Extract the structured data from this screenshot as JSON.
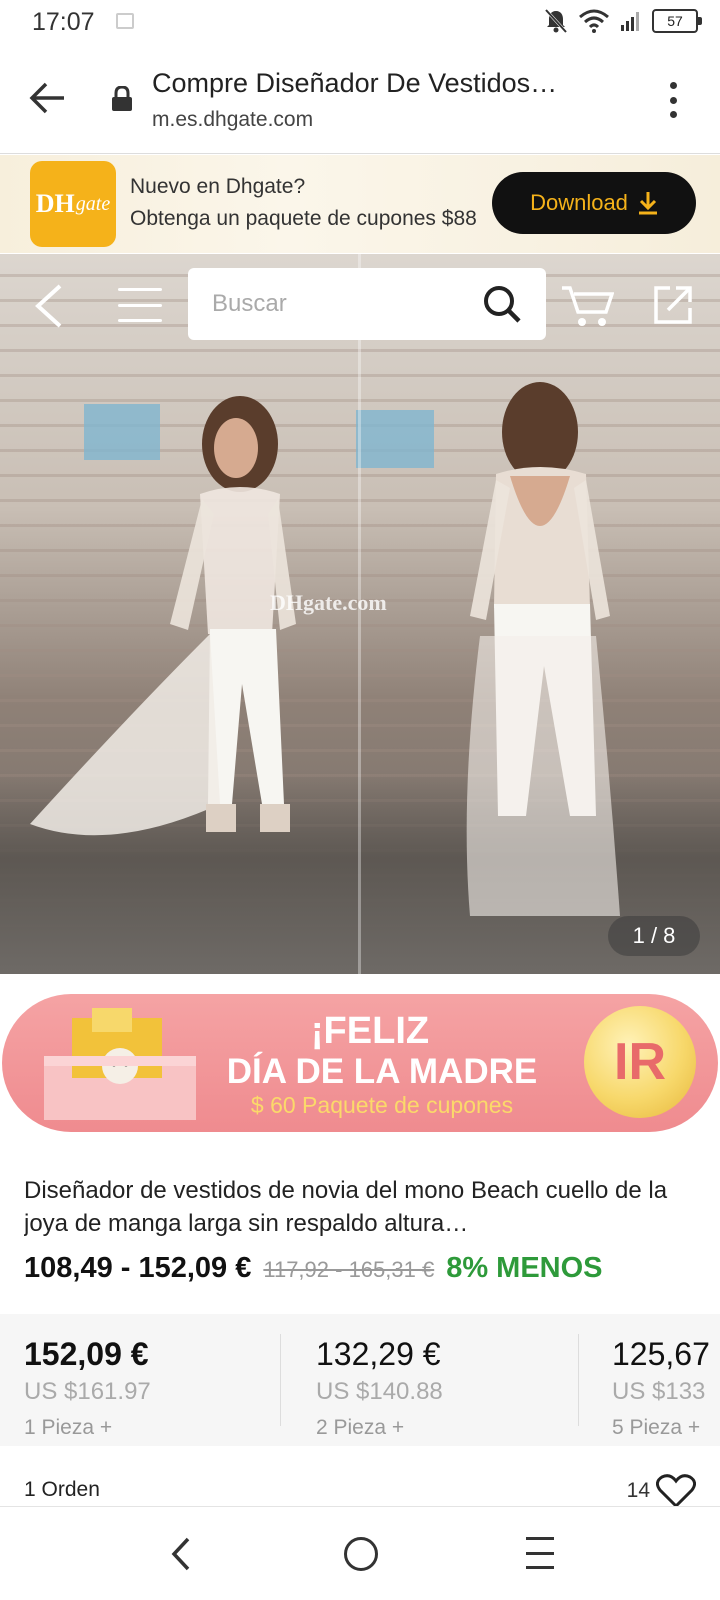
{
  "status_bar": {
    "time": "17:07",
    "battery": "57",
    "icons": [
      "image-icon",
      "mute-icon",
      "wifi-icon",
      "signal-icon",
      "battery-icon"
    ]
  },
  "browser": {
    "title": "Compre Diseñador De Vestidos…",
    "url": "m.es.dhgate.com"
  },
  "app_banner": {
    "logo_main": "DH",
    "logo_sub": "gate",
    "line1": "Nuevo en Dhgate?",
    "line2": "Obtenga un paquete de cupones $88",
    "download_label": "Download"
  },
  "hero": {
    "search_placeholder": "Buscar",
    "counter": "1 / 8",
    "watermark": "DHgate.com"
  },
  "promo": {
    "line1": "¡FELIZ",
    "line2": "DÍA DE LA MADRE",
    "line3": "$ 60 Paquete de cupones",
    "button": "IR"
  },
  "product": {
    "title": "Diseñador de vestidos de novia del mono Beach cuello de la joya de manga larga sin respaldo altura…",
    "price_range": "108,49 - 152,09 €",
    "old_price": "117,92 - 165,31 €",
    "discount": "8% MENOS"
  },
  "tiers": [
    {
      "price": "152,09 €",
      "usd": "US $161.97",
      "qty": "1 Pieza +"
    },
    {
      "price": "132,29 €",
      "usd": "US $140.88",
      "qty": "2 Pieza +"
    },
    {
      "price": "125,67",
      "usd": "US $133",
      "qty": "5 Pieza +"
    }
  ],
  "footer_info": {
    "orders": "1 Orden",
    "likes": "14"
  },
  "colors": {
    "brand_yellow": "#f5b21a",
    "promo_pink": "#ef8b8f",
    "discount_green": "#2e9a3a"
  }
}
